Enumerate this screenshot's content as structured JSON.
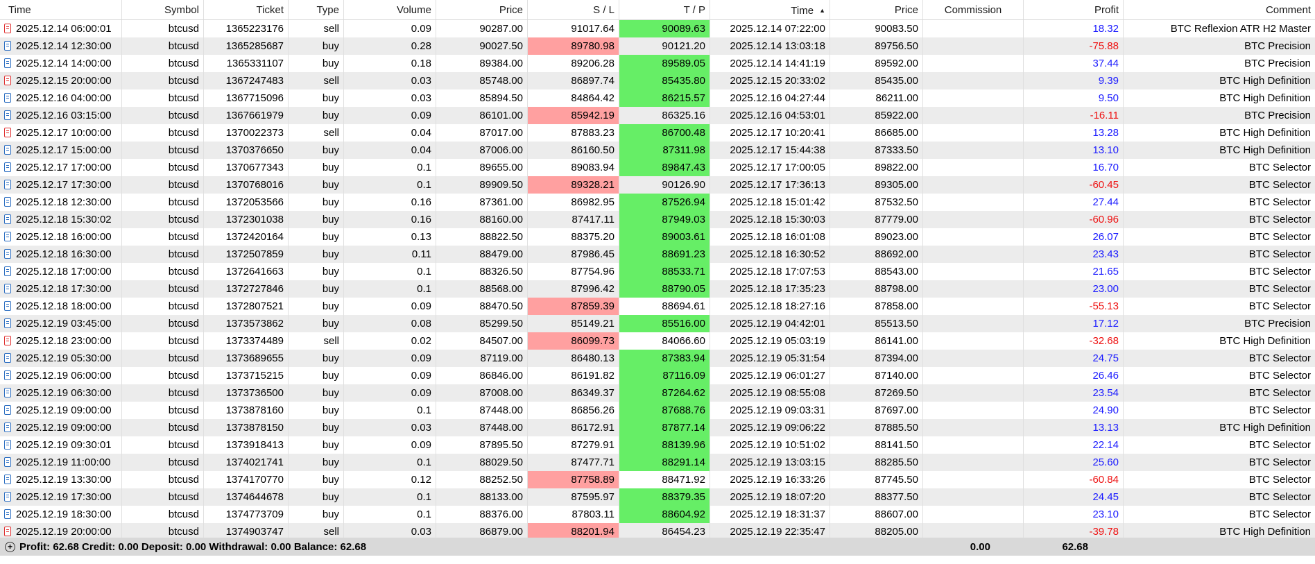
{
  "columns": [
    "Time",
    "Symbol",
    "Ticket",
    "Type",
    "Volume",
    "Price",
    "S / L",
    "T / P",
    "Time",
    "Price",
    "Commission",
    "Profit",
    "Comment"
  ],
  "sort_indicator": "▲",
  "rows": [
    [
      "2025.12.14 06:00:01",
      "btcusd",
      "1365223176",
      "sell",
      "0.09",
      "90287.00",
      "91017.64",
      "90089.63",
      "2025.12.14 07:22:00",
      "90083.50",
      "",
      "18.32",
      "BTC Reflexion ATR H2 Master",
      "tp"
    ],
    [
      "2025.12.14 12:30:00",
      "btcusd",
      "1365285687",
      "buy",
      "0.28",
      "90027.50",
      "89780.98",
      "90121.20",
      "2025.12.14 13:03:18",
      "89756.50",
      "",
      "-75.88",
      "BTC Precision",
      "sl"
    ],
    [
      "2025.12.14 14:00:00",
      "btcusd",
      "1365331107",
      "buy",
      "0.18",
      "89384.00",
      "89206.28",
      "89589.05",
      "2025.12.14 14:41:19",
      "89592.00",
      "",
      "37.44",
      "BTC Precision",
      "tp"
    ],
    [
      "2025.12.15 20:00:00",
      "btcusd",
      "1367247483",
      "sell",
      "0.03",
      "85748.00",
      "86897.74",
      "85435.80",
      "2025.12.15 20:33:02",
      "85435.00",
      "",
      "9.39",
      "BTC High Definition",
      "tp"
    ],
    [
      "2025.12.16 04:00:00",
      "btcusd",
      "1367715096",
      "buy",
      "0.03",
      "85894.50",
      "84864.42",
      "86215.57",
      "2025.12.16 04:27:44",
      "86211.00",
      "",
      "9.50",
      "BTC High Definition",
      "tp"
    ],
    [
      "2025.12.16 03:15:00",
      "btcusd",
      "1367661979",
      "buy",
      "0.09",
      "86101.00",
      "85942.19",
      "86325.16",
      "2025.12.16 04:53:01",
      "85922.00",
      "",
      "-16.11",
      "BTC Precision",
      "sl"
    ],
    [
      "2025.12.17 10:00:00",
      "btcusd",
      "1370022373",
      "sell",
      "0.04",
      "87017.00",
      "87883.23",
      "86700.48",
      "2025.12.17 10:20:41",
      "86685.00",
      "",
      "13.28",
      "BTC High Definition",
      "tp"
    ],
    [
      "2025.12.17 15:00:00",
      "btcusd",
      "1370376650",
      "buy",
      "0.04",
      "87006.00",
      "86160.50",
      "87311.98",
      "2025.12.17 15:44:38",
      "87333.50",
      "",
      "13.10",
      "BTC High Definition",
      "tp"
    ],
    [
      "2025.12.17 17:00:00",
      "btcusd",
      "1370677343",
      "buy",
      "0.1",
      "89655.00",
      "89083.94",
      "89847.43",
      "2025.12.17 17:00:05",
      "89822.00",
      "",
      "16.70",
      "BTC Selector",
      "tp"
    ],
    [
      "2025.12.17 17:30:00",
      "btcusd",
      "1370768016",
      "buy",
      "0.1",
      "89909.50",
      "89328.21",
      "90126.90",
      "2025.12.17 17:36:13",
      "89305.00",
      "",
      "-60.45",
      "BTC Selector",
      "sl"
    ],
    [
      "2025.12.18 12:30:00",
      "btcusd",
      "1372053566",
      "buy",
      "0.16",
      "87361.00",
      "86982.95",
      "87526.94",
      "2025.12.18 15:01:42",
      "87532.50",
      "",
      "27.44",
      "BTC Selector",
      "tp"
    ],
    [
      "2025.12.18 15:30:02",
      "btcusd",
      "1372301038",
      "buy",
      "0.16",
      "88160.00",
      "87417.11",
      "87949.03",
      "2025.12.18 15:30:03",
      "87779.00",
      "",
      "-60.96",
      "BTC Selector",
      "tp"
    ],
    [
      "2025.12.18 16:00:00",
      "btcusd",
      "1372420164",
      "buy",
      "0.13",
      "88822.50",
      "88375.20",
      "89003.61",
      "2025.12.18 16:01:08",
      "89023.00",
      "",
      "26.07",
      "BTC Selector",
      "tp"
    ],
    [
      "2025.12.18 16:30:00",
      "btcusd",
      "1372507859",
      "buy",
      "0.11",
      "88479.00",
      "87986.45",
      "88691.23",
      "2025.12.18 16:30:52",
      "88692.00",
      "",
      "23.43",
      "BTC Selector",
      "tp"
    ],
    [
      "2025.12.18 17:00:00",
      "btcusd",
      "1372641663",
      "buy",
      "0.1",
      "88326.50",
      "87754.96",
      "88533.71",
      "2025.12.18 17:07:53",
      "88543.00",
      "",
      "21.65",
      "BTC Selector",
      "tp"
    ],
    [
      "2025.12.18 17:30:00",
      "btcusd",
      "1372727846",
      "buy",
      "0.1",
      "88568.00",
      "87996.42",
      "88790.05",
      "2025.12.18 17:35:23",
      "88798.00",
      "",
      "23.00",
      "BTC Selector",
      "tp"
    ],
    [
      "2025.12.18 18:00:00",
      "btcusd",
      "1372807521",
      "buy",
      "0.09",
      "88470.50",
      "87859.39",
      "88694.61",
      "2025.12.18 18:27:16",
      "87858.00",
      "",
      "-55.13",
      "BTC Selector",
      "sl"
    ],
    [
      "2025.12.19 03:45:00",
      "btcusd",
      "1373573862",
      "buy",
      "0.08",
      "85299.50",
      "85149.21",
      "85516.00",
      "2025.12.19 04:42:01",
      "85513.50",
      "",
      "17.12",
      "BTC Precision",
      "tp"
    ],
    [
      "2025.12.18 23:00:00",
      "btcusd",
      "1373374489",
      "sell",
      "0.02",
      "84507.00",
      "86099.73",
      "84066.60",
      "2025.12.19 05:03:19",
      "86141.00",
      "",
      "-32.68",
      "BTC High Definition",
      "sl"
    ],
    [
      "2025.12.19 05:30:00",
      "btcusd",
      "1373689655",
      "buy",
      "0.09",
      "87119.00",
      "86480.13",
      "87383.94",
      "2025.12.19 05:31:54",
      "87394.00",
      "",
      "24.75",
      "BTC Selector",
      "tp"
    ],
    [
      "2025.12.19 06:00:00",
      "btcusd",
      "1373715215",
      "buy",
      "0.09",
      "86846.00",
      "86191.82",
      "87116.09",
      "2025.12.19 06:01:27",
      "87140.00",
      "",
      "26.46",
      "BTC Selector",
      "tp"
    ],
    [
      "2025.12.19 06:30:00",
      "btcusd",
      "1373736500",
      "buy",
      "0.09",
      "87008.00",
      "86349.37",
      "87264.62",
      "2025.12.19 08:55:08",
      "87269.50",
      "",
      "23.54",
      "BTC Selector",
      "tp"
    ],
    [
      "2025.12.19 09:00:00",
      "btcusd",
      "1373878160",
      "buy",
      "0.1",
      "87448.00",
      "86856.26",
      "87688.76",
      "2025.12.19 09:03:31",
      "87697.00",
      "",
      "24.90",
      "BTC Selector",
      "tp"
    ],
    [
      "2025.12.19 09:00:00",
      "btcusd",
      "1373878150",
      "buy",
      "0.03",
      "87448.00",
      "86172.91",
      "87877.14",
      "2025.12.19 09:06:22",
      "87885.50",
      "",
      "13.13",
      "BTC High Definition",
      "tp"
    ],
    [
      "2025.12.19 09:30:01",
      "btcusd",
      "1373918413",
      "buy",
      "0.09",
      "87895.50",
      "87279.91",
      "88139.96",
      "2025.12.19 10:51:02",
      "88141.50",
      "",
      "22.14",
      "BTC Selector",
      "tp"
    ],
    [
      "2025.12.19 11:00:00",
      "btcusd",
      "1374021741",
      "buy",
      "0.1",
      "88029.50",
      "87477.71",
      "88291.14",
      "2025.12.19 13:03:15",
      "88285.50",
      "",
      "25.60",
      "BTC Selector",
      "tp"
    ],
    [
      "2025.12.19 13:30:00",
      "btcusd",
      "1374170770",
      "buy",
      "0.12",
      "88252.50",
      "87758.89",
      "88471.92",
      "2025.12.19 16:33:26",
      "87745.50",
      "",
      "-60.84",
      "BTC Selector",
      "sl"
    ],
    [
      "2025.12.19 17:30:00",
      "btcusd",
      "1374644678",
      "buy",
      "0.1",
      "88133.00",
      "87595.97",
      "88379.35",
      "2025.12.19 18:07:20",
      "88377.50",
      "",
      "24.45",
      "BTC Selector",
      "tp"
    ],
    [
      "2025.12.19 18:30:00",
      "btcusd",
      "1374773709",
      "buy",
      "0.1",
      "88376.00",
      "87803.11",
      "88604.92",
      "2025.12.19 18:31:37",
      "88607.00",
      "",
      "23.10",
      "BTC Selector",
      "tp"
    ],
    [
      "2025.12.19 20:00:00",
      "btcusd",
      "1374903747",
      "sell",
      "0.03",
      "86879.00",
      "88201.94",
      "86454.23",
      "2025.12.19 22:35:47",
      "88205.00",
      "",
      "-39.78",
      "BTC High Definition",
      "sl"
    ]
  ],
  "footer": {
    "summary": "Profit: 62.68  Credit: 0.00  Deposit: 0.00  Withdrawal: 0.00  Balance: 62.68",
    "commission_total": "0.00",
    "profit_total": "62.68"
  },
  "colors": {
    "sl_hit": "#ffa0a0",
    "tp_hit": "#66ee66",
    "profit_pos": "#1a1aff",
    "profit_neg": "#ee1111"
  }
}
